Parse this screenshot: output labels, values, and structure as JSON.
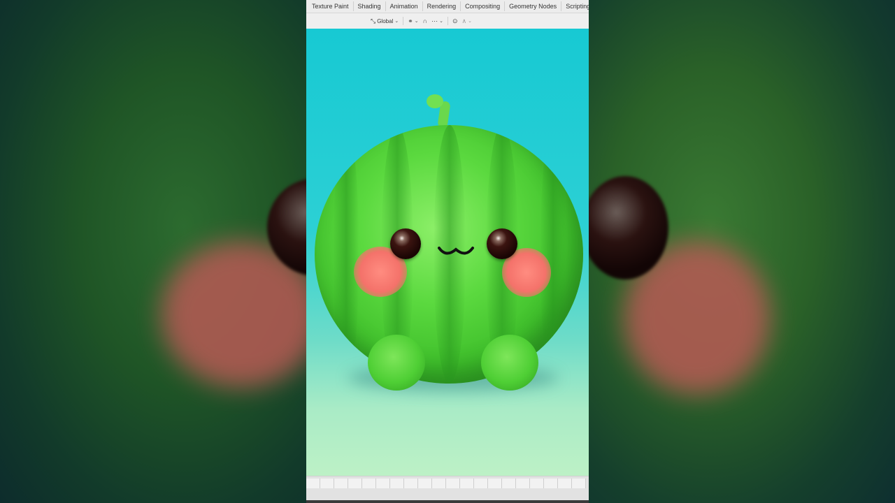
{
  "workspace_tabs": [
    "Texture Paint",
    "Shading",
    "Animation",
    "Rendering",
    "Compositing",
    "Geometry Nodes",
    "Scripting"
  ],
  "toolbar": {
    "orientation_icon": "transform-orientation-icon",
    "orientation_label": "Global",
    "pivot_icon": "link-pivot-icon",
    "snap_icon": "magnet-snap-icon",
    "snap_increment_icon": "snap-increment-icon",
    "proportional_icon": "proportional-edit-icon",
    "falloff_icon": "falloff-curve-icon"
  },
  "colors": {
    "background_top": "#17c9d3",
    "background_bottom": "#bdf1c6",
    "watermelon_green": "#4fcf35",
    "cheek_pink": "#f4726a"
  }
}
